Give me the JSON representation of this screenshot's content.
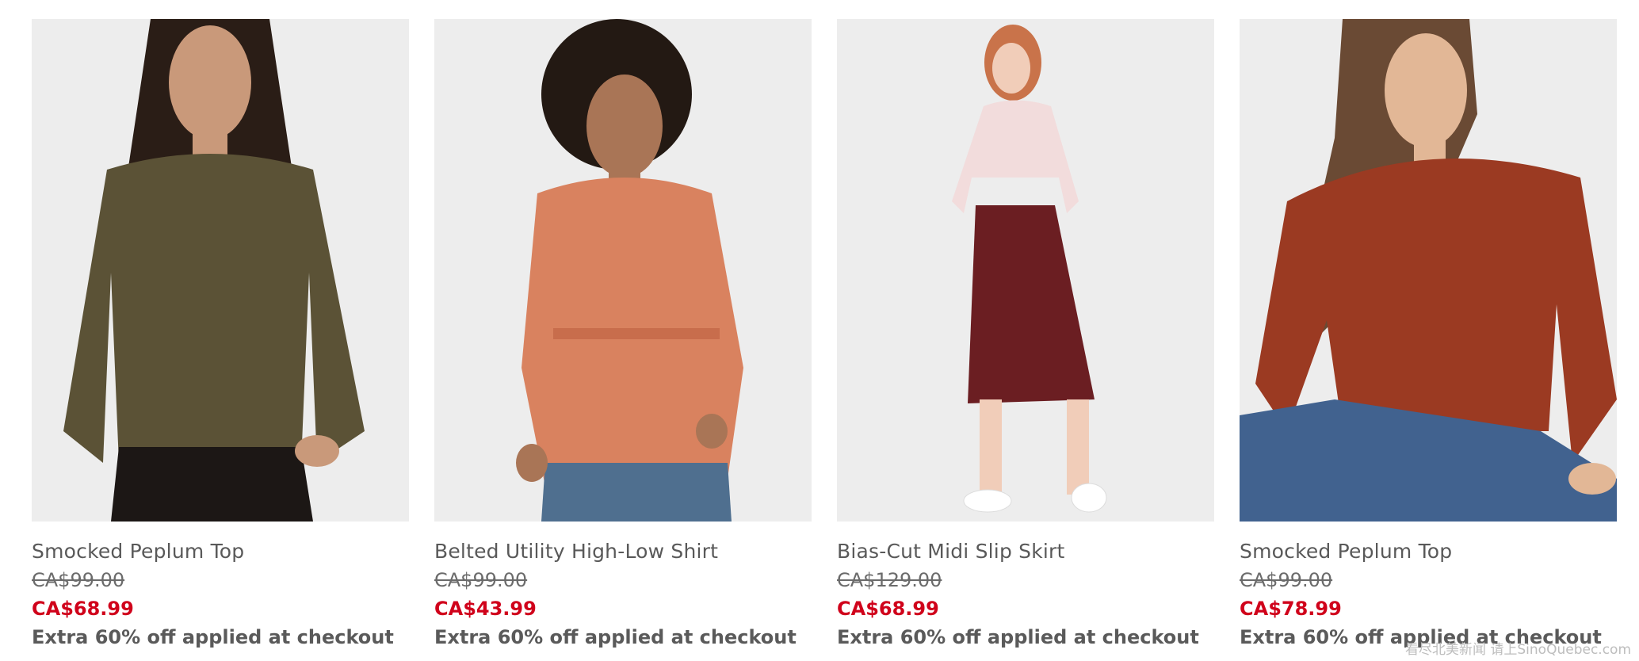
{
  "products": [
    {
      "name": "Smocked Peplum Top",
      "original_price": "CA$99.00",
      "sale_price": "CA$68.99",
      "promo": "Extra 60% off applied at checkout",
      "colors": {
        "garment": "#5b5236",
        "hair": "#2a1d16",
        "skin": "#c9997a",
        "legs": "#1c1715"
      }
    },
    {
      "name": "Belted Utility High-Low Shirt",
      "original_price": "CA$99.00",
      "sale_price": "CA$43.99",
      "promo": "Extra 60% off applied at checkout",
      "colors": {
        "garment": "#d9825f",
        "hair": "#231913",
        "skin": "#a97556",
        "legs": "#4f6f8f"
      }
    },
    {
      "name": "Bias-Cut Midi Slip Skirt",
      "original_price": "CA$129.00",
      "sale_price": "CA$68.99",
      "promo": "Extra 60% off applied at checkout",
      "colors": {
        "garment": "#6b1e22",
        "top": "#f2dcdc",
        "hair": "#c9734a",
        "skin": "#f1cdb9",
        "shoes": "#ffffff"
      }
    },
    {
      "name": "Smocked Peplum Top",
      "original_price": "CA$99.00",
      "sale_price": "CA$78.99",
      "promo": "Extra 60% off applied at checkout",
      "colors": {
        "garment": "#9b3a22",
        "hair": "#6a4a34",
        "skin": "#e2b796",
        "legs": "#41628f"
      }
    }
  ],
  "watermark": "看尽北美新闻 请上SinoQuebec.com",
  "theme": {
    "sale_color": "#d0021b",
    "photo_background": "#eeeeee"
  }
}
